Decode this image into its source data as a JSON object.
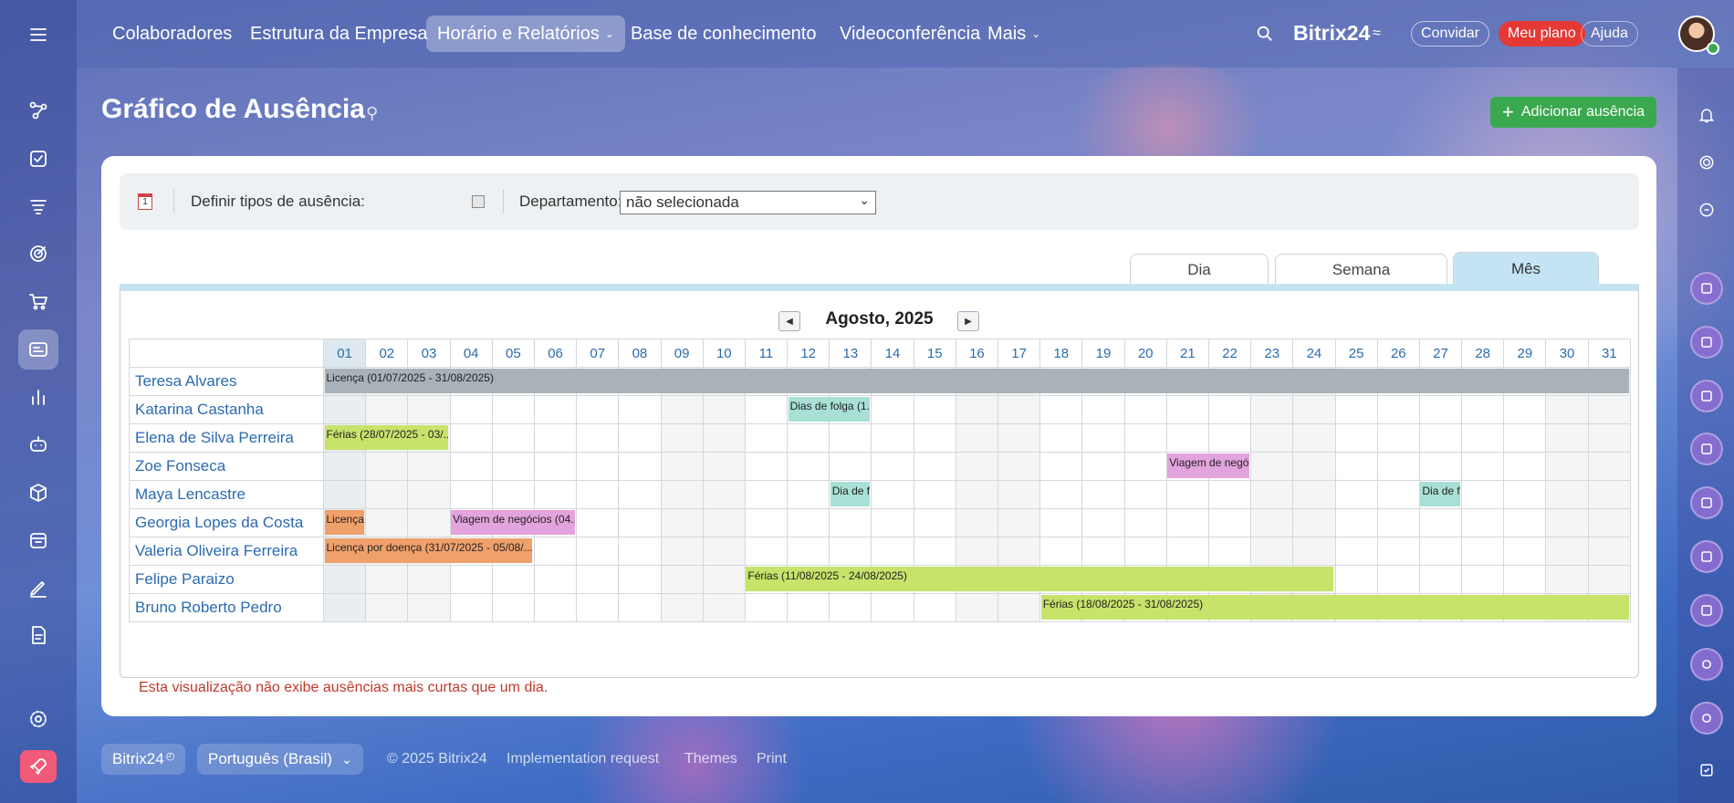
{
  "colors": {
    "accent": "#3aa84e",
    "plan": "#e53935",
    "blue": "#2a6ab1",
    "tab": "#c5e4f3"
  },
  "topnav": {
    "items": [
      {
        "label": "Colaboradores"
      },
      {
        "label": "Estrutura da Empresa"
      },
      {
        "label": "Horário e Relatórios"
      },
      {
        "label": "Base de conhecimento"
      },
      {
        "label": "Videoconferência"
      },
      {
        "label": "Mais"
      }
    ],
    "brand": "Bitrix24",
    "invite": "Convidar",
    "plan": "Meu plano",
    "help": "Ajuda"
  },
  "page": {
    "title": "Gráfico de Ausência",
    "add_button": "Adicionar ausência"
  },
  "filter": {
    "types_label": "Definir tipos de ausência:",
    "dept_label": "Departamento:",
    "dept_value": "não selecionada",
    "calendar_day": "1"
  },
  "tabs": {
    "day": "Dia",
    "week": "Semana",
    "month": "Mês"
  },
  "calendar": {
    "month_label": "Agosto, 2025",
    "days": [
      "01",
      "02",
      "03",
      "04",
      "05",
      "06",
      "07",
      "08",
      "09",
      "10",
      "11",
      "12",
      "13",
      "14",
      "15",
      "16",
      "17",
      "18",
      "19",
      "20",
      "21",
      "22",
      "23",
      "24",
      "25",
      "26",
      "27",
      "28",
      "29",
      "30",
      "31"
    ],
    "employees": [
      "Teresa Alvares",
      "Katarina Castanha",
      "Elena de Silva Perreira",
      "Zoe Fonseca",
      "Maya Lencastre",
      "Georgia Lopes da Costa",
      "Valeria Oliveira Ferreira",
      "Felipe Paraizo",
      "Bruno Roberto Pedro"
    ],
    "absences": [
      {
        "row": 0,
        "start": 1,
        "end": 31,
        "label": "Licença (01/07/2025 - 31/08/2025)",
        "color": "#a9b2b8"
      },
      {
        "row": 1,
        "start": 12,
        "end": 13,
        "label": "Dias de folga (1...",
        "color": "#a8e0d5"
      },
      {
        "row": 2,
        "start": 1,
        "end": 3,
        "label": "Férias (28/07/2025 - 03/...",
        "color": "#c7e36a"
      },
      {
        "row": 3,
        "start": 21,
        "end": 22,
        "label": "Viagem de negó...",
        "color": "#e3a3dd"
      },
      {
        "row": 4,
        "start": 13,
        "end": 13,
        "label": "Dia de f...",
        "color": "#a8e0d5"
      },
      {
        "row": 4,
        "start": 27,
        "end": 27,
        "label": "Dia de f...",
        "color": "#a8e0d5"
      },
      {
        "row": 5,
        "start": 1,
        "end": 1,
        "label": "Licença...",
        "color": "#f0a06a"
      },
      {
        "row": 5,
        "start": 4,
        "end": 6,
        "label": "Viagem de negócios (04...",
        "color": "#e3a3dd"
      },
      {
        "row": 6,
        "start": 1,
        "end": 5,
        "label": "Licença por doença (31/07/2025 - 05/08/...",
        "color": "#f0a06a"
      },
      {
        "row": 7,
        "start": 11,
        "end": 24,
        "label": "Férias (11/08/2025 - 24/08/2025)",
        "color": "#c7e36a"
      },
      {
        "row": 8,
        "start": 18,
        "end": 31,
        "label": "Férias (18/08/2025 - 31/08/2025)",
        "color": "#c7e36a"
      }
    ],
    "note": "Esta visualização não exibe ausências mais curtas que um dia."
  },
  "footer": {
    "brand": "Bitrix24",
    "language": "Português (Brasil)",
    "copyright": "© 2025 Bitrix24",
    "implementation": "Implementation request",
    "themes": "Themes",
    "print": "Print"
  }
}
